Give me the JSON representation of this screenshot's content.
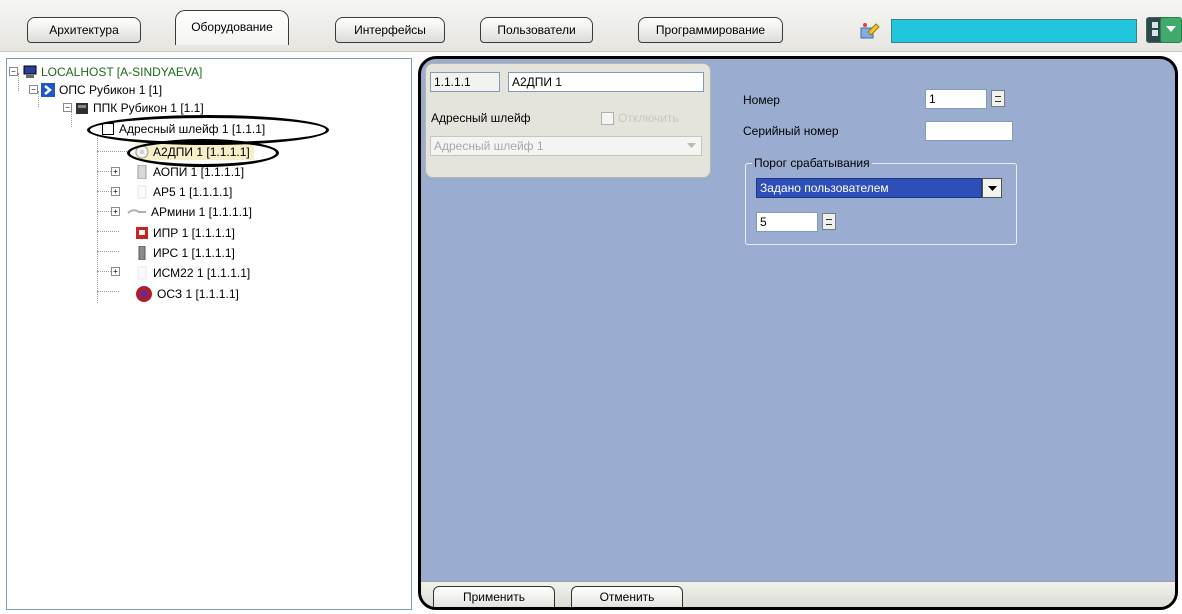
{
  "tabs": [
    {
      "label": "Архитектура"
    },
    {
      "label": "Оборудование"
    },
    {
      "label": "Интерфейсы"
    },
    {
      "label": "Пользователи"
    },
    {
      "label": "Программирование"
    }
  ],
  "toolbar": {
    "search_value": "",
    "accent_color": "#22c6dc"
  },
  "tree": {
    "root": "LOCALHOST [A-SINDYAEVA]",
    "ops": "ОПС Рубикон 1 [1]",
    "ppk": "ППК Рубикон 1 [1.1]",
    "loop": "Адресный шлейф 1 [1.1.1]",
    "devices": [
      {
        "label": "А2ДПИ 1 [1.1.1.1]",
        "icon": "smoke-detector-icon"
      },
      {
        "label": "АОПИ 1 [1.1.1.1]",
        "icon": "device-icon"
      },
      {
        "label": "АР5 1 [1.1.1.1]",
        "icon": "device-icon"
      },
      {
        "label": "АРмини 1 [1.1.1.1]",
        "icon": "device-icon"
      },
      {
        "label": "ИПР 1 [1.1.1.1]",
        "icon": "manual-call-point-icon"
      },
      {
        "label": "ИРС 1 [1.1.1.1]",
        "icon": "device-icon"
      },
      {
        "label": "ИСМ22 1 [1.1.1.1]",
        "icon": "device-icon"
      },
      {
        "label": "ОСЗ 1 [1.1.1.1]",
        "icon": "siren-icon"
      }
    ]
  },
  "settings": {
    "id_value": "1.1.1.1",
    "name_value": "А2ДПИ 1",
    "parent_label": "Адресный шлейф",
    "disable_label": "Отключить",
    "parent_value": "Адресный шлейф 1",
    "number_label": "Номер",
    "number_value": "1",
    "serial_label": "Серийный номер",
    "serial_value": "",
    "threshold_group_label": "Порог срабатывания",
    "threshold_mode": "Задано пользователем",
    "threshold_value": "5",
    "apply_label": "Применить",
    "cancel_label": "Отменить"
  }
}
